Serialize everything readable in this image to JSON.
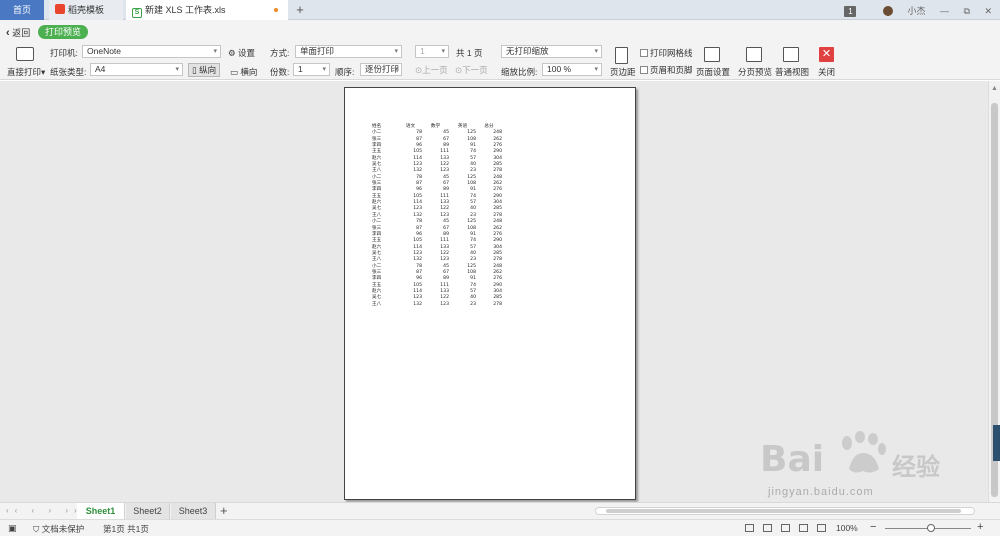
{
  "tabs": {
    "home": "首页",
    "templates": "稻壳模板",
    "document": "新建 XLS 工作表.xls",
    "new_tab": "+"
  },
  "window": {
    "badge": "1",
    "user": "小杰",
    "minimize": "—",
    "restore": "⧉",
    "close": "✕"
  },
  "toolbar": {
    "back": "返回",
    "print_preview": "打印预览",
    "direct_print": "直接打印",
    "printer_label": "打印机:",
    "printer_value": "OneNote",
    "settings": "设置",
    "paper_label": "纸张类型:",
    "paper_value": "A4",
    "portrait": "纵向",
    "landscape": "横向",
    "mode_label": "方式:",
    "mode_value": "单面打印",
    "copies_label": "份数:",
    "copies_value": "1",
    "order_label": "顺序:",
    "order_value": "逐份打印",
    "page_value": "1",
    "total_pages": "共 1 页",
    "prev_page": "上一页",
    "next_page": "下一页",
    "scaling_value": "无打印缩放",
    "zoom_label": "缩放比例:",
    "zoom_value": "100 %",
    "margins": "页边距",
    "gridlines": "打印网格线",
    "header_footer": "页眉和页脚",
    "page_setup": "页面设置",
    "page_break_preview": "分页预览",
    "normal_view": "普通视图",
    "close": "关闭"
  },
  "sheet": {
    "headers": [
      "姓名",
      "语文",
      "数学",
      "英语",
      "总分"
    ],
    "rows": [
      [
        "小二",
        "78",
        "45",
        "125",
        "248"
      ],
      [
        "张三",
        "87",
        "67",
        "108",
        "262"
      ],
      [
        "李四",
        "96",
        "89",
        "91",
        "276"
      ],
      [
        "王五",
        "105",
        "111",
        "74",
        "290"
      ],
      [
        "赵六",
        "114",
        "133",
        "57",
        "304"
      ],
      [
        "吴七",
        "123",
        "122",
        "40",
        "285"
      ],
      [
        "王八",
        "132",
        "123",
        "23",
        "278"
      ],
      [
        "小二",
        "78",
        "45",
        "125",
        "248"
      ],
      [
        "张三",
        "87",
        "67",
        "108",
        "262"
      ],
      [
        "李四",
        "96",
        "89",
        "91",
        "276"
      ],
      [
        "王五",
        "105",
        "111",
        "74",
        "290"
      ],
      [
        "赵六",
        "114",
        "133",
        "57",
        "304"
      ],
      [
        "吴七",
        "123",
        "122",
        "40",
        "285"
      ],
      [
        "王八",
        "132",
        "123",
        "23",
        "278"
      ],
      [
        "小二",
        "78",
        "45",
        "125",
        "248"
      ],
      [
        "张三",
        "87",
        "67",
        "108",
        "262"
      ],
      [
        "李四",
        "96",
        "89",
        "91",
        "276"
      ],
      [
        "王五",
        "105",
        "111",
        "74",
        "290"
      ],
      [
        "赵六",
        "114",
        "133",
        "57",
        "304"
      ],
      [
        "吴七",
        "123",
        "122",
        "40",
        "285"
      ],
      [
        "王八",
        "132",
        "123",
        "23",
        "278"
      ],
      [
        "小二",
        "78",
        "45",
        "125",
        "248"
      ],
      [
        "张三",
        "87",
        "67",
        "108",
        "262"
      ],
      [
        "李四",
        "96",
        "89",
        "91",
        "276"
      ],
      [
        "王五",
        "105",
        "111",
        "74",
        "290"
      ],
      [
        "赵六",
        "114",
        "133",
        "57",
        "304"
      ],
      [
        "吴七",
        "123",
        "122",
        "40",
        "285"
      ],
      [
        "王八",
        "132",
        "123",
        "23",
        "278"
      ]
    ]
  },
  "sheet_tabs": [
    "Sheet1",
    "Sheet2",
    "Sheet3"
  ],
  "status": {
    "protection": "文档未保护",
    "page_info": "第1页 共1页",
    "zoom": "100%"
  },
  "watermark": {
    "brand": "Bai",
    "brand2": "经验",
    "url": "jingyan.baidu.com"
  },
  "colors": {
    "accent_green": "#4caf50",
    "home_tab": "#4a78c2",
    "close_red": "#e04040"
  }
}
